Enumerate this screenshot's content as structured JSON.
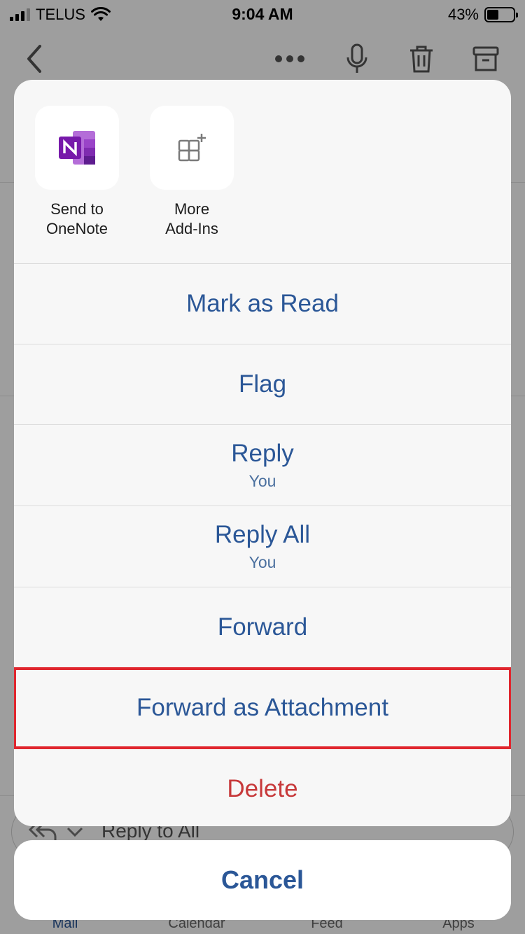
{
  "status_bar": {
    "carrier": "TELUS",
    "time": "9:04 AM",
    "battery_percent": "43%",
    "battery_level": 0.43
  },
  "nav_bar": {
    "icons": [
      "back-chevron-icon",
      "more-icon",
      "microphone-icon",
      "trash-icon",
      "archive-icon"
    ]
  },
  "background": {
    "reply_bar_text": "Reply to All",
    "tabs": [
      {
        "label": "Mail",
        "active": true
      },
      {
        "label": "Calendar",
        "active": false
      },
      {
        "label": "Feed",
        "active": false
      },
      {
        "label": "Apps",
        "active": false
      }
    ]
  },
  "action_sheet": {
    "addins": [
      {
        "label": "Send to\nOneNote",
        "icon": "onenote-icon"
      },
      {
        "label": "More\nAdd-Ins",
        "icon": "add-grid-icon"
      }
    ],
    "actions": [
      {
        "label": "Mark as Read",
        "sub": ""
      },
      {
        "label": "Flag",
        "sub": ""
      },
      {
        "label": "Reply",
        "sub": "You"
      },
      {
        "label": "Reply All",
        "sub": "You"
      },
      {
        "label": "Forward",
        "sub": ""
      },
      {
        "label": "Forward as Attachment",
        "sub": ""
      },
      {
        "label": "Delete",
        "sub": ""
      }
    ],
    "cancel_label": "Cancel"
  },
  "colors": {
    "accent": "#2b5797",
    "danger": "#c7393a",
    "highlight_border": "#e0262e",
    "onenote_purple": "#7719aa"
  }
}
